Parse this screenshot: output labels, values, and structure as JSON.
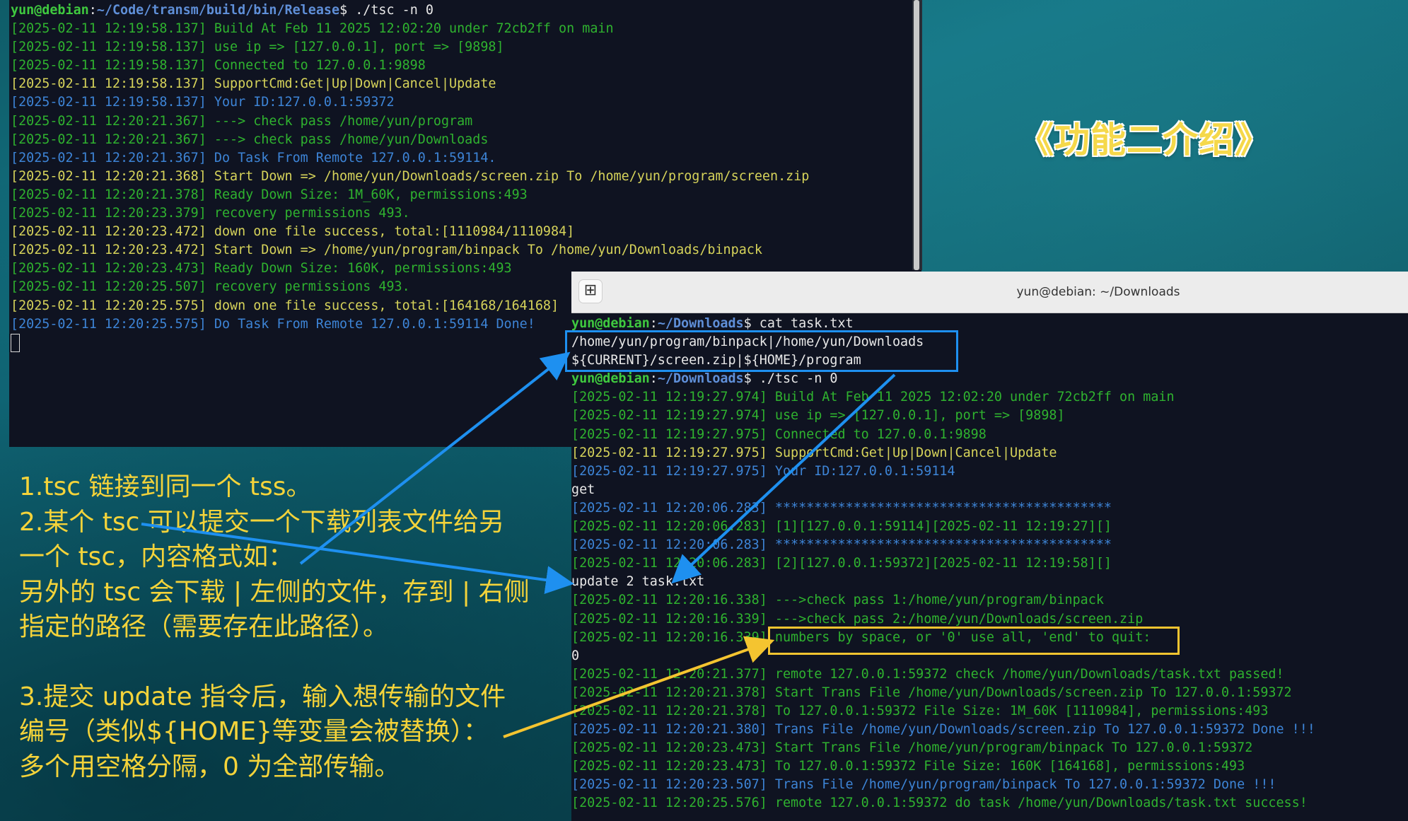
{
  "terminal_left": {
    "prompt": {
      "user": "yun@debian",
      "sep": ":",
      "path": "~/Code/transm/build/bin/Release",
      "cmd": "$ ./tsc -n 0"
    },
    "lines": [
      {
        "c": "g",
        "t": "[2025-02-11 12:19:58.137] Build At Feb 11 2025 12:02:20 under 72cb2ff on main"
      },
      {
        "c": "g",
        "t": "[2025-02-11 12:19:58.137] use ip => [127.0.0.1], port => [9898]"
      },
      {
        "c": "g",
        "t": "[2025-02-11 12:19:58.137] Connected to 127.0.0.1:9898"
      },
      {
        "c": "y",
        "t": "[2025-02-11 12:19:58.137] SupportCmd:Get|Up|Down|Cancel|Update"
      },
      {
        "c": "b",
        "t": "[2025-02-11 12:19:58.137] Your ID:127.0.0.1:59372"
      },
      {
        "c": "g",
        "t": "[2025-02-11 12:20:21.367] ---> check pass /home/yun/program"
      },
      {
        "c": "g",
        "t": "[2025-02-11 12:20:21.367] ---> check pass /home/yun/Downloads"
      },
      {
        "c": "b",
        "t": "[2025-02-11 12:20:21.367] Do Task From Remote 127.0.0.1:59114."
      },
      {
        "c": "y",
        "t": "[2025-02-11 12:20:21.368] Start Down => /home/yun/Downloads/screen.zip To /home/yun/program/screen.zip"
      },
      {
        "c": "g",
        "t": "[2025-02-11 12:20:21.378] Ready Down Size: 1M_60K, permissions:493"
      },
      {
        "c": "g",
        "t": "[2025-02-11 12:20:23.379] recovery permissions 493."
      },
      {
        "c": "y",
        "t": "[2025-02-11 12:20:23.472] down one file success, total:[1110984/1110984]"
      },
      {
        "c": "y",
        "t": "[2025-02-11 12:20:23.472] Start Down => /home/yun/program/binpack To /home/yun/Downloads/binpack"
      },
      {
        "c": "g",
        "t": "[2025-02-11 12:20:23.473] Ready Down Size: 160K, permissions:493"
      },
      {
        "c": "g",
        "t": "[2025-02-11 12:20:25.507] recovery permissions 493."
      },
      {
        "c": "y",
        "t": "[2025-02-11 12:20:25.575] down one file success, total:[164168/164168]"
      },
      {
        "c": "b",
        "t": "[2025-02-11 12:20:25.575] Do Task From Remote 127.0.0.1:59114 Done!"
      }
    ]
  },
  "terminal_right": {
    "title": "yun@debian: ~/Downloads",
    "new_tab_icon": "new-tab-icon",
    "prompt1": {
      "user": "yun@debian",
      "sep": ":",
      "path": "~/Downloads",
      "cmd": "$ cat task.txt"
    },
    "file_lines": [
      "/home/yun/program/binpack|/home/yun/Downloads",
      "${CURRENT}/screen.zip|${HOME}/program"
    ],
    "prompt2": {
      "user": "yun@debian",
      "sep": ":",
      "path": "~/Downloads",
      "cmd": "$ ./tsc -n 0"
    },
    "lines": [
      {
        "c": "g",
        "t": "[2025-02-11 12:19:27.974] Build At Feb 11 2025 12:02:20 under 72cb2ff on main"
      },
      {
        "c": "g",
        "t": "[2025-02-11 12:19:27.974] use ip => [127.0.0.1], port => [9898]"
      },
      {
        "c": "g",
        "t": "[2025-02-11 12:19:27.975] Connected to 127.0.0.1:9898"
      },
      {
        "c": "y",
        "t": "[2025-02-11 12:19:27.975] SupportCmd:Get|Up|Down|Cancel|Update"
      },
      {
        "c": "b",
        "t": "[2025-02-11 12:19:27.975] Your ID:127.0.0.1:59114"
      },
      {
        "c": "w",
        "t": "get"
      },
      {
        "c": "b",
        "t": "[2025-02-11 12:20:06.283] *******************************************"
      },
      {
        "c": "g",
        "t": "[2025-02-11 12:20:06.283] [1][127.0.0.1:59114][2025-02-11 12:19:27][]"
      },
      {
        "c": "b",
        "t": "[2025-02-11 12:20:06.283] *******************************************"
      },
      {
        "c": "g",
        "t": "[2025-02-11 12:20:06.283] [2][127.0.0.1:59372][2025-02-11 12:19:58][]"
      },
      {
        "c": "w",
        "t": "update 2 task.txt"
      },
      {
        "c": "g",
        "t": "[2025-02-11 12:20:16.338] --->check pass 1:/home/yun/program/binpack"
      },
      {
        "c": "g",
        "t": "[2025-02-11 12:20:16.339] --->check pass 2:/home/yun/Downloads/screen.zip"
      },
      {
        "c": "g",
        "t": "[2025-02-11 12:20:16.339] numbers by space, or '0' use all, 'end' to quit:"
      },
      {
        "c": "w",
        "t": "0"
      },
      {
        "c": "g",
        "t": "[2025-02-11 12:20:21.377] remote 127.0.0.1:59372 check /home/yun/Downloads/task.txt passed!"
      },
      {
        "c": "g",
        "t": "[2025-02-11 12:20:21.378] Start Trans File /home/yun/Downloads/screen.zip To 127.0.0.1:59372"
      },
      {
        "c": "g",
        "t": "[2025-02-11 12:20:21.378] To 127.0.0.1:59372 File Size: 1M_60K [1110984], permissions:493"
      },
      {
        "c": "b",
        "t": "[2025-02-11 12:20:21.380] Trans File /home/yun/Downloads/screen.zip To 127.0.0.1:59372 Done !!!"
      },
      {
        "c": "g",
        "t": "[2025-02-11 12:20:23.473] Start Trans File /home/yun/program/binpack To 127.0.0.1:59372"
      },
      {
        "c": "g",
        "t": "[2025-02-11 12:20:23.473] To 127.0.0.1:59372 File Size: 160K [164168], permissions:493"
      },
      {
        "c": "b",
        "t": "[2025-02-11 12:20:23.507] Trans File /home/yun/program/binpack To 127.0.0.1:59372 Done !!!"
      },
      {
        "c": "g",
        "t": "[2025-02-11 12:20:25.576] remote 127.0.0.1:59372 do task /home/yun/Downloads/task.txt success!"
      }
    ]
  },
  "heading": "《功能二介绍》",
  "explanation": {
    "lines1": [
      "1.tsc 链接到同一个 tss。",
      "2.某个 tsc 可以提交一个下载列表文件给另",
      "一个 tsc，内容格式如：",
      "另外的 tsc 会下载 | 左侧的文件，存到 | 右侧",
      "指定的路径（需要存在此路径）。"
    ],
    "lines2": [
      "3.提交 update 指令后，输入想传输的文件",
      "编号（类似${HOME}等变量会被替换）：",
      "多个用空格分隔，0 为全部传输。"
    ]
  },
  "colors": {
    "annotation_blue": "#1e90f0",
    "annotation_yellow": "#f4c430",
    "text_yellow": "#f4d33a"
  }
}
